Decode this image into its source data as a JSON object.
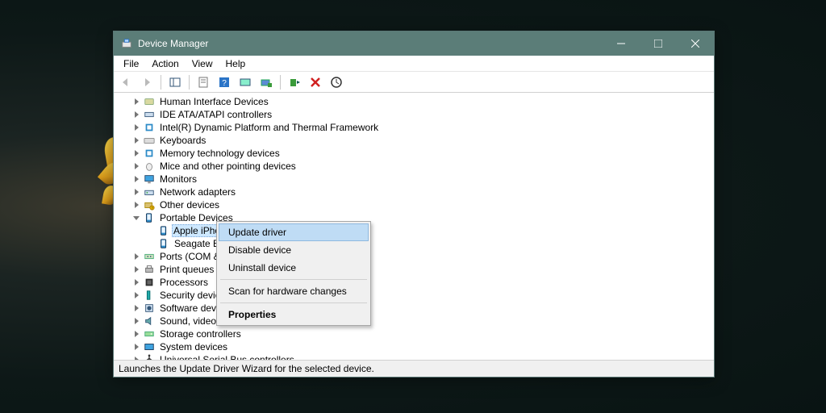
{
  "window": {
    "title": "Device Manager",
    "menu": [
      "File",
      "Action",
      "View",
      "Help"
    ],
    "statusbar": "Launches the Update Driver Wizard for the selected device."
  },
  "tree": {
    "categories": [
      {
        "label": "Human Interface Devices",
        "icon": "hid",
        "expanded": false
      },
      {
        "label": "IDE ATA/ATAPI controllers",
        "icon": "ide",
        "expanded": false
      },
      {
        "label": "Intel(R) Dynamic Platform and Thermal Framework",
        "icon": "chip",
        "expanded": false
      },
      {
        "label": "Keyboards",
        "icon": "keyboard",
        "expanded": false
      },
      {
        "label": "Memory technology devices",
        "icon": "chip",
        "expanded": false
      },
      {
        "label": "Mice and other pointing devices",
        "icon": "mouse",
        "expanded": false
      },
      {
        "label": "Monitors",
        "icon": "monitor",
        "expanded": false
      },
      {
        "label": "Network adapters",
        "icon": "network",
        "expanded": false
      },
      {
        "label": "Other devices",
        "icon": "other",
        "expanded": false
      },
      {
        "label": "Portable Devices",
        "icon": "portable",
        "expanded": true,
        "children": [
          {
            "label": "Apple iPhone",
            "icon": "portable",
            "selected": true
          },
          {
            "label": "Seagate E",
            "icon": "portable",
            "selected": false,
            "truncated": true
          }
        ]
      },
      {
        "label": "Ports (COM &",
        "icon": "ports",
        "expanded": false,
        "truncated": true
      },
      {
        "label": "Print queues",
        "icon": "printer",
        "expanded": false
      },
      {
        "label": "Processors",
        "icon": "cpu",
        "expanded": false
      },
      {
        "label": "Security devic",
        "icon": "security",
        "expanded": false,
        "truncated": true
      },
      {
        "label": "Software devi",
        "icon": "software",
        "expanded": false,
        "truncated": true
      },
      {
        "label": "Sound, video",
        "icon": "sound",
        "expanded": false,
        "truncated": true
      },
      {
        "label": "Storage controllers",
        "icon": "storage",
        "expanded": false
      },
      {
        "label": "System devices",
        "icon": "system",
        "expanded": false
      },
      {
        "label": "Universal Serial Bus controllers",
        "icon": "usb",
        "expanded": false
      }
    ]
  },
  "context_menu": {
    "items": [
      {
        "label": "Update driver",
        "highlighted": true
      },
      {
        "label": "Disable device"
      },
      {
        "label": "Uninstall device"
      },
      {
        "separator": true
      },
      {
        "label": "Scan for hardware changes"
      },
      {
        "separator": true
      },
      {
        "label": "Properties",
        "bold": true
      }
    ]
  },
  "toolbar": {
    "buttons": [
      {
        "name": "back-icon",
        "disabled": true
      },
      {
        "name": "forward-icon",
        "disabled": true
      },
      {
        "sep": true
      },
      {
        "name": "show-hide-tree-icon"
      },
      {
        "sep": true
      },
      {
        "name": "properties-icon"
      },
      {
        "name": "help-icon"
      },
      {
        "name": "scan-hardware-icon"
      },
      {
        "name": "update-driver-icon"
      },
      {
        "sep": true
      },
      {
        "name": "enable-icon"
      },
      {
        "name": "uninstall-icon"
      },
      {
        "name": "action-icon"
      }
    ]
  }
}
